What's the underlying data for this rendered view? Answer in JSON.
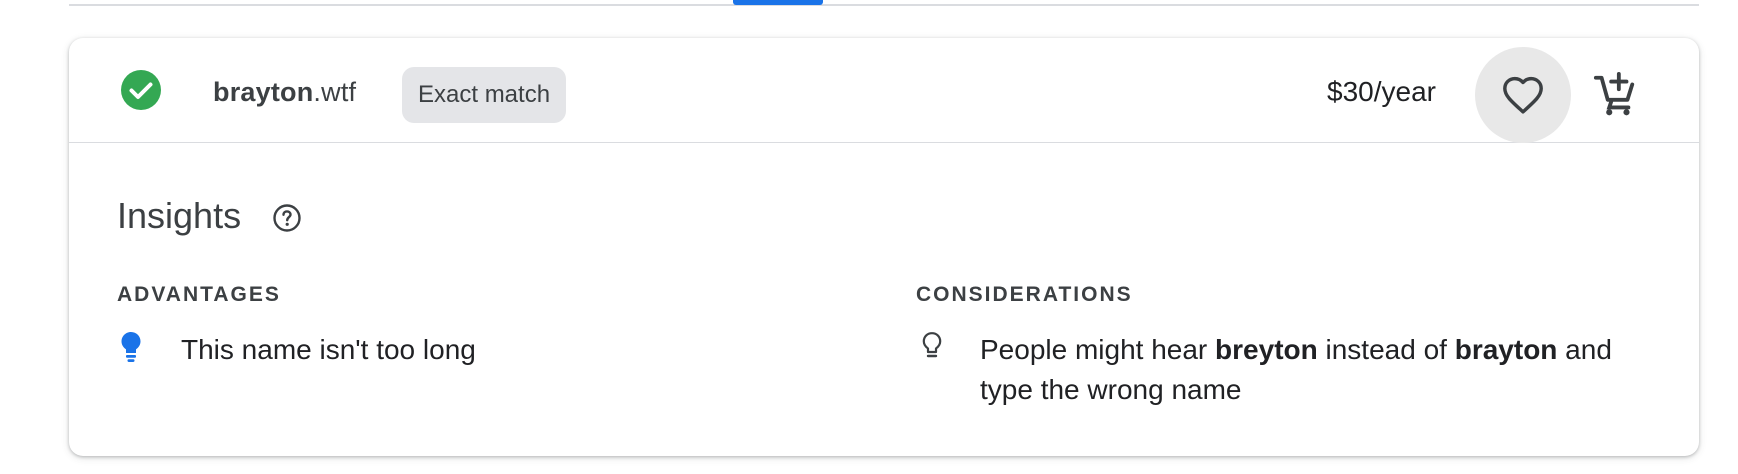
{
  "colors": {
    "accent": "#1a73e8",
    "success": "#34a853",
    "chip_bg": "#e4e5e8",
    "fav_bg": "#e8e8e8"
  },
  "result": {
    "status_icon": "check-circle-icon",
    "domain_sld": "brayton",
    "domain_tld": ".wtf",
    "match_chip": "Exact match",
    "price": "$30/year",
    "favorite_icon": "heart-outline-icon",
    "cart_icon": "add-shopping-cart-icon"
  },
  "insights": {
    "title": "Insights",
    "help_icon": "help-circle-icon",
    "advantages": {
      "label": "ADVANTAGES",
      "icon": "lightbulb-filled-icon",
      "items": [
        "This name isn't too long"
      ]
    },
    "considerations": {
      "label": "CONSIDERATIONS",
      "icon": "lightbulb-outline-icon",
      "text_1": "People might hear ",
      "bold_1": "breyton",
      "text_2": " instead of ",
      "bold_2": "brayton",
      "text_3": " and type the wrong name"
    }
  }
}
